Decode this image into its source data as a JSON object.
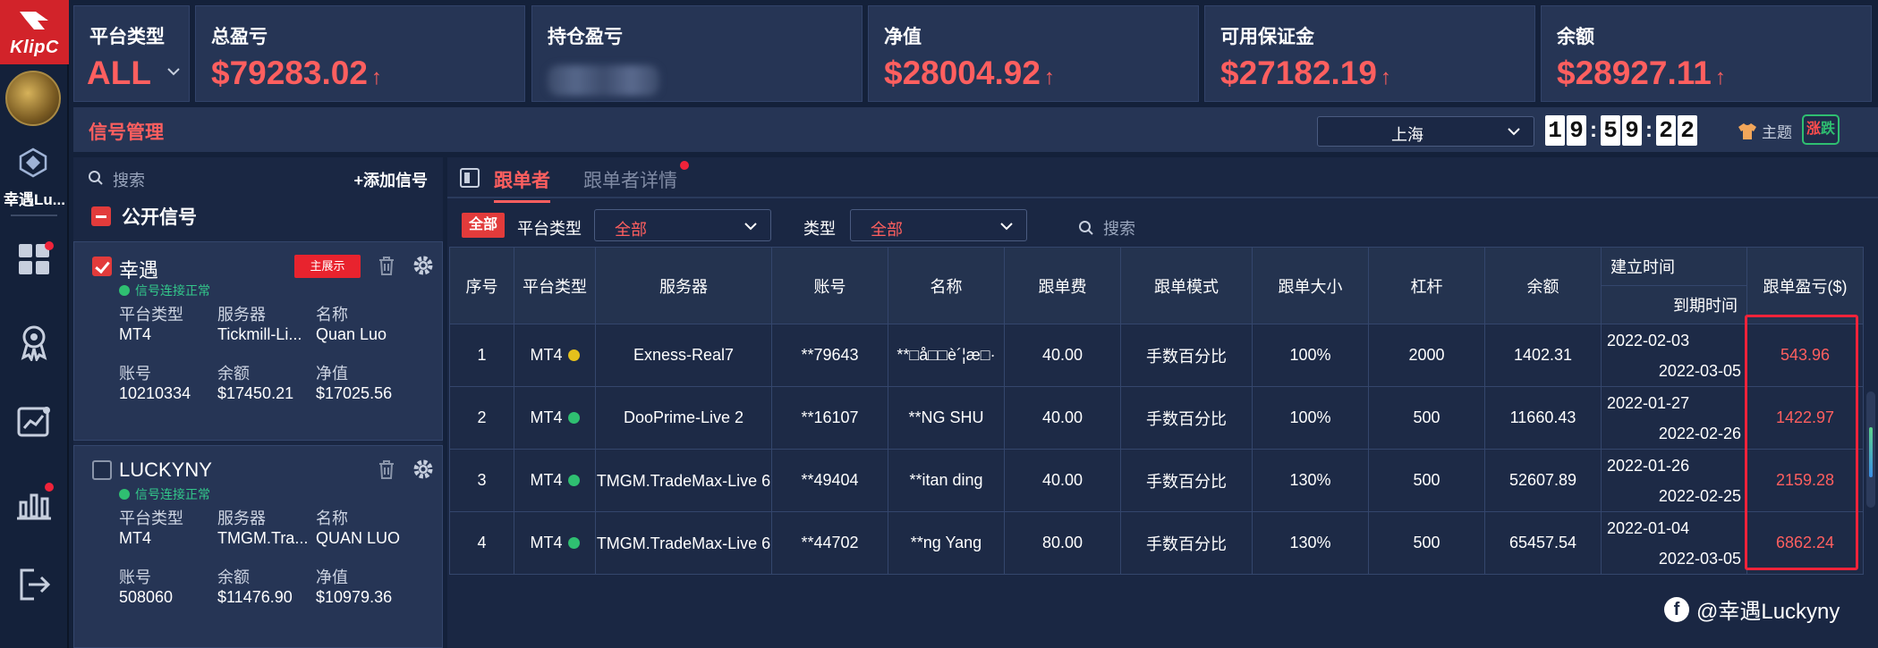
{
  "brand": {
    "logo_text": "KlipC"
  },
  "user": {
    "name": "幸遇Lu..."
  },
  "stats": {
    "platform": {
      "label": "平台类型",
      "value": "ALL"
    },
    "total_pnl": {
      "label": "总盈亏",
      "value": "$79283.02"
    },
    "position_pnl": {
      "label": "持仓盈亏"
    },
    "equity": {
      "label": "净值",
      "value": "$28004.92"
    },
    "free_margin": {
      "label": "可用保证金",
      "value": "$27182.19"
    },
    "balance": {
      "label": "余额",
      "value": "$28927.11"
    },
    "up_arrow": "↑"
  },
  "header": {
    "title": "信号管理",
    "city": "上海",
    "clock": [
      "1",
      "9",
      ":",
      "5",
      "9",
      ":",
      "2",
      "2"
    ],
    "theme_label": "主题",
    "zd_up": "涨",
    "zd_down": "跌"
  },
  "signals": {
    "search_placeholder": "搜索",
    "add_label": "+添加信号",
    "public_label": "公开信号",
    "cards": [
      {
        "name": "幸遇",
        "checked": true,
        "status": "信号连接正常",
        "tag": "主展示",
        "platform_k": "平台类型",
        "platform_v": "MT4",
        "server_k": "服务器",
        "server_v": "Tickmill-Li...",
        "name_k": "名称",
        "name_v": "Quan Luo",
        "account_k": "账号",
        "account_v": "10210334",
        "balance_k": "余额",
        "balance_v": "$17450.21",
        "equity_k": "净值",
        "equity_v": "$17025.56"
      },
      {
        "name": "LUCKYNY",
        "checked": false,
        "status": "信号连接正常",
        "platform_k": "平台类型",
        "platform_v": "MT4",
        "server_k": "服务器",
        "server_v": "TMGM.Tra...",
        "name_k": "名称",
        "name_v": "QUAN LUO",
        "account_k": "账号",
        "account_v": "508060",
        "balance_k": "余额",
        "balance_v": "$11476.90",
        "equity_k": "净值",
        "equity_v": "$10979.36"
      }
    ]
  },
  "followers": {
    "tab_followers": "跟单者",
    "tab_detail": "跟单者详情",
    "filter_all": "全部",
    "filter_platform_label": "平台类型",
    "filter_platform_value": "全部",
    "filter_type_label": "类型",
    "filter_type_value": "全部",
    "search_placeholder": "搜索",
    "columns": {
      "index": "序号",
      "platform": "平台类型",
      "server": "服务器",
      "account": "账号",
      "name": "名称",
      "fee": "跟单费",
      "mode": "跟单模式",
      "size": "跟单大小",
      "leverage": "杠杆",
      "balance": "余额",
      "created": "建立时间",
      "expire": "到期时间",
      "pnl": "跟单盈亏($)"
    },
    "rows": [
      {
        "index": "1",
        "platform": "MT4",
        "dot_color": "#e5c01c",
        "server": "Exness-Real7",
        "account": "**79643",
        "name": "**□å□□è´¦æ□·",
        "fee": "40.00",
        "mode": "手数百分比",
        "size": "100%",
        "leverage": "2000",
        "balance": "1402.31",
        "created": "2022-02-03",
        "expire": "2022-03-05",
        "pnl": "543.96"
      },
      {
        "index": "2",
        "platform": "MT4",
        "dot_color": "#2fbf71",
        "server": "DooPrime-Live 2",
        "account": "**16107",
        "name": "**NG SHU",
        "fee": "40.00",
        "mode": "手数百分比",
        "size": "100%",
        "leverage": "500",
        "balance": "11660.43",
        "created": "2022-01-27",
        "expire": "2022-02-26",
        "pnl": "1422.97"
      },
      {
        "index": "3",
        "platform": "MT4",
        "dot_color": "#2fbf71",
        "server": "TMGM.TradeMax-Live 6",
        "account": "**49404",
        "name": "**itan ding",
        "fee": "40.00",
        "mode": "手数百分比",
        "size": "130%",
        "leverage": "500",
        "balance": "52607.89",
        "created": "2022-01-26",
        "expire": "2022-02-25",
        "pnl": "2159.28"
      },
      {
        "index": "4",
        "platform": "MT4",
        "dot_color": "#2fbf71",
        "server": "TMGM.TradeMax-Live 6",
        "account": "**44702",
        "name": "**ng Yang",
        "fee": "80.00",
        "mode": "手数百分比",
        "size": "130%",
        "leverage": "500",
        "balance": "65457.54",
        "created": "2022-01-04",
        "expire": "2022-03-05",
        "pnl": "6862.24"
      }
    ]
  },
  "watermark": {
    "icon": "f",
    "text": "@幸遇Luckyny"
  },
  "colors": {
    "accent_red": "#ff5f5f",
    "brand_red": "#d2232a",
    "ok_green": "#2fbf71",
    "panel": "#263555",
    "bg": "#14213a"
  }
}
